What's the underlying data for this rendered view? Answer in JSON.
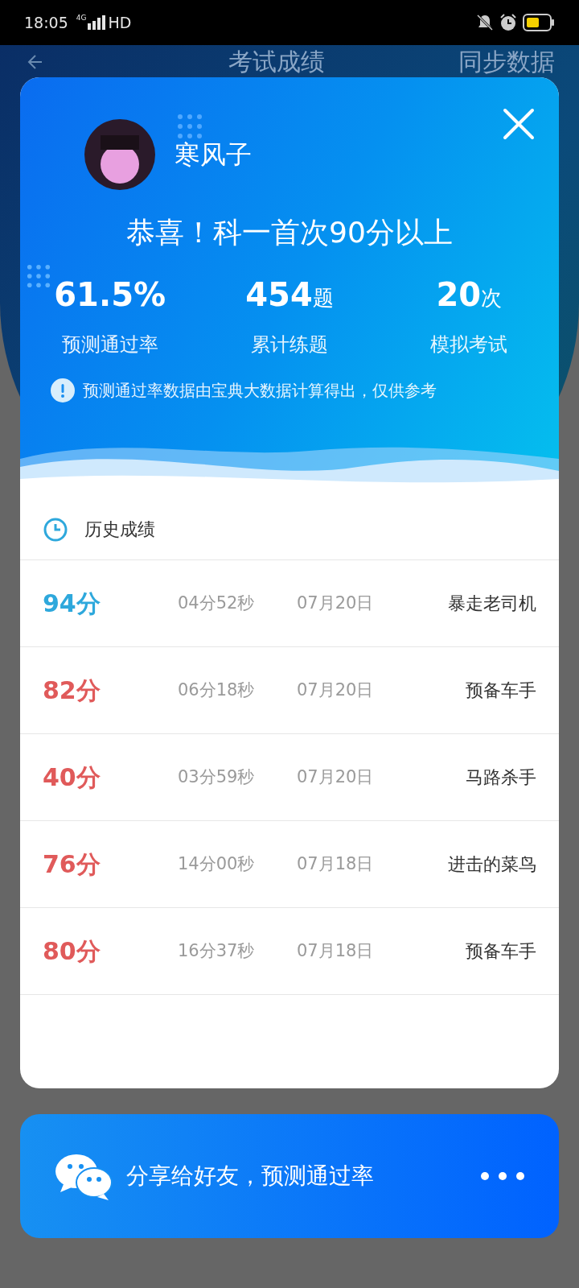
{
  "status_bar": {
    "time": "18:05",
    "network": "4G",
    "hd": "HD"
  },
  "page_header": {
    "title": "考试成绩",
    "action": "同步数据"
  },
  "dialog": {
    "user_name": "寒风子",
    "headline": "恭喜！科一首次90分以上",
    "stats": [
      {
        "value": "61.5%",
        "label": "预测通过率"
      },
      {
        "value": "454",
        "unit": "题",
        "label": "累计练题"
      },
      {
        "value": "20",
        "unit": "次",
        "label": "模拟考试"
      }
    ],
    "note": "预测通过率数据由宝典大数据计算得出，仅供参考",
    "history_title": "历史成绩",
    "history": [
      {
        "score": "94分",
        "color": "#2ea8dc",
        "duration": "04分52秒",
        "date": "07月20日",
        "rank": "暴走老司机"
      },
      {
        "score": "82分",
        "color": "#e05a5a",
        "duration": "06分18秒",
        "date": "07月20日",
        "rank": "预备车手"
      },
      {
        "score": "40分",
        "color": "#e05a5a",
        "duration": "03分59秒",
        "date": "07月20日",
        "rank": "马路杀手"
      },
      {
        "score": "76分",
        "color": "#e05a5a",
        "duration": "14分00秒",
        "date": "07月18日",
        "rank": "进击的菜鸟"
      },
      {
        "score": "80分",
        "color": "#e05a5a",
        "duration": "16分37秒",
        "date": "07月18日",
        "rank": "预备车手"
      }
    ]
  },
  "share": {
    "label": "分享给好友，预测通过率"
  }
}
